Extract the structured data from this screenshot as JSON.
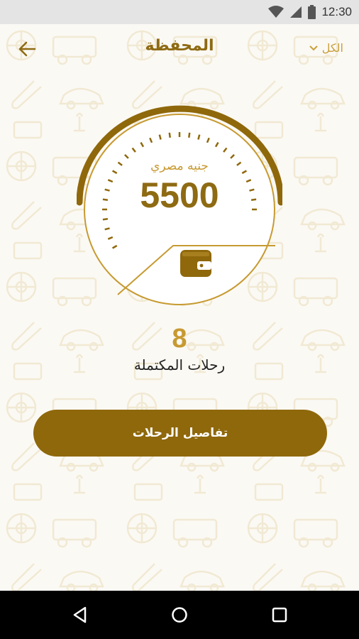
{
  "status_bar": {
    "time": "12:30"
  },
  "header": {
    "title": "المحفظة",
    "filter_label": "الكل"
  },
  "wallet": {
    "currency": "جنيه مصري",
    "balance": "5500"
  },
  "trips": {
    "count": "8",
    "label": "رحلات المكتملة"
  },
  "actions": {
    "details_label": "تفاصيل الرحلات"
  },
  "colors": {
    "primary": "#8f680b",
    "accent": "#c79a31",
    "background": "#fbf9f4"
  }
}
